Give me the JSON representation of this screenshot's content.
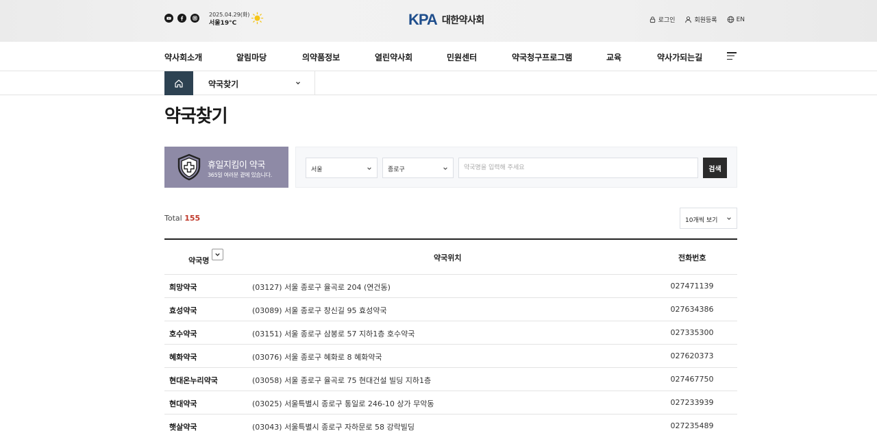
{
  "header": {
    "sns": [
      "youtube-icon",
      "facebook-icon",
      "instagram-icon"
    ],
    "date": "2025.04.29(화)",
    "weather": "서울19°C",
    "logo_mark": "KPA",
    "logo_text": "대한약사회",
    "util": {
      "login": "로그인",
      "join": "회원등록",
      "lang": "EN"
    }
  },
  "gnb": [
    "약사회소개",
    "알림마당",
    "의약품정보",
    "열린약사회",
    "민원센터",
    "약국청구프로그램",
    "교육",
    "약사가되는길"
  ],
  "breadcrumb": {
    "current": "약국찾기"
  },
  "page_title": "약국찾기",
  "holiday": {
    "title": "휴일지킴이 약국",
    "desc": "365일 여러분 곁에 있습니다."
  },
  "search": {
    "city": "서울",
    "district": "종로구",
    "placeholder": "약국명을 입력해 주세요",
    "button": "검색"
  },
  "total": {
    "label": "Total",
    "count": "155"
  },
  "perpage": "10개씩 보기",
  "table": {
    "headers": {
      "name": "약국명",
      "addr": "약국위치",
      "tel": "전화번호"
    },
    "rows": [
      {
        "name": "희망약국",
        "addr": "(03127) 서울 종로구 율곡로 204 (연건동)",
        "tel": "027471139"
      },
      {
        "name": "효성약국",
        "addr": "(03089) 서울 종로구 창신길 95 효성약국",
        "tel": "027634386"
      },
      {
        "name": "호수약국",
        "addr": "(03151) 서울 종로구 삼봉로 57 지하1층 호수약국",
        "tel": "027335300"
      },
      {
        "name": "혜화약국",
        "addr": "(03076) 서울 종로구 혜화로 8 혜화약국",
        "tel": "027620373"
      },
      {
        "name": "현대온누리약국",
        "addr": "(03058) 서울 종로구 율곡로 75 현대건설 빌딩 지하1층",
        "tel": "027467750"
      },
      {
        "name": "현대약국",
        "addr": "(03025) 서울특별시 종로구 통일로 246-10 상가 무악동",
        "tel": "027233939"
      },
      {
        "name": "햇살약국",
        "addr": "(03043) 서울특별시 종로구 자하문로 58 강락빌딩",
        "tel": "027235489"
      }
    ]
  },
  "colors": {
    "brand": "#1f4e8c",
    "home_btn": "#2d4252",
    "holiday_bg": "#8e8aa6",
    "total_count": "#c0392b"
  }
}
